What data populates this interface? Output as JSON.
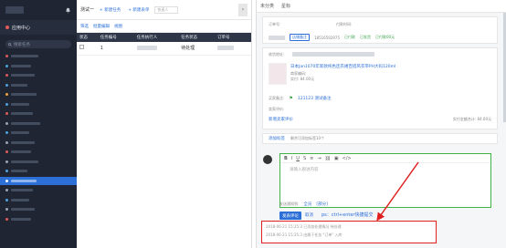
{
  "sidebar": {
    "app_label": "应用中心",
    "search_placeholder": "搜索任务",
    "items": 22
  },
  "list": {
    "title": "测试一",
    "new_task": "+ 新建任务",
    "new_form": "+ 新建表单",
    "search_placeholder": "快速人",
    "toolbar": [
      "筛选",
      "批量编辑",
      "视图"
    ],
    "headers": [
      "状态",
      "任务编号",
      "任务执行人",
      "任务状态",
      "订单号"
    ],
    "rows": [
      {
        "num": "1",
        "status": "待处理"
      }
    ]
  },
  "detail": {
    "tabs": [
      "未分类",
      "星标"
    ],
    "order_label": "订单号:",
    "pay_label": "付款时间:",
    "buyer_tag": "店铺备注",
    "phone": "18516592975",
    "status_values": [
      "已付款",
      "已发货",
      "已付款00元"
    ],
    "addr_label": "收货地址:",
    "product_title": "日本Jan1070年新款纯色连衣裙百搭风衣带PH大码120ml",
    "product_meta": "商家编码:",
    "product_price": "实付: 84.00元",
    "note_label": "买家备注:",
    "note_value": "121123 测试备注",
    "seller_label": "卖家评价:",
    "seller_btn": "新增卖家评价",
    "total_label": "实付金额合计: 84.00元",
    "flag_label": "添加标签",
    "flag_text": "剩余可添加标签10个",
    "editor_placeholder": "请输入跟进内容",
    "notify_label": "发送通知到:",
    "notify_opts": [
      "全员",
      "[部分]"
    ],
    "submit": "发表评论",
    "cancel": "取消",
    "annotation": "ps：ctrl+enter快捷提交",
    "logs": [
      "2018-06-21 15:25:3 已添加处理情况 待处理",
      "2018-06-21 15:25:3 由属于任务 \"订单\" 入库"
    ]
  }
}
